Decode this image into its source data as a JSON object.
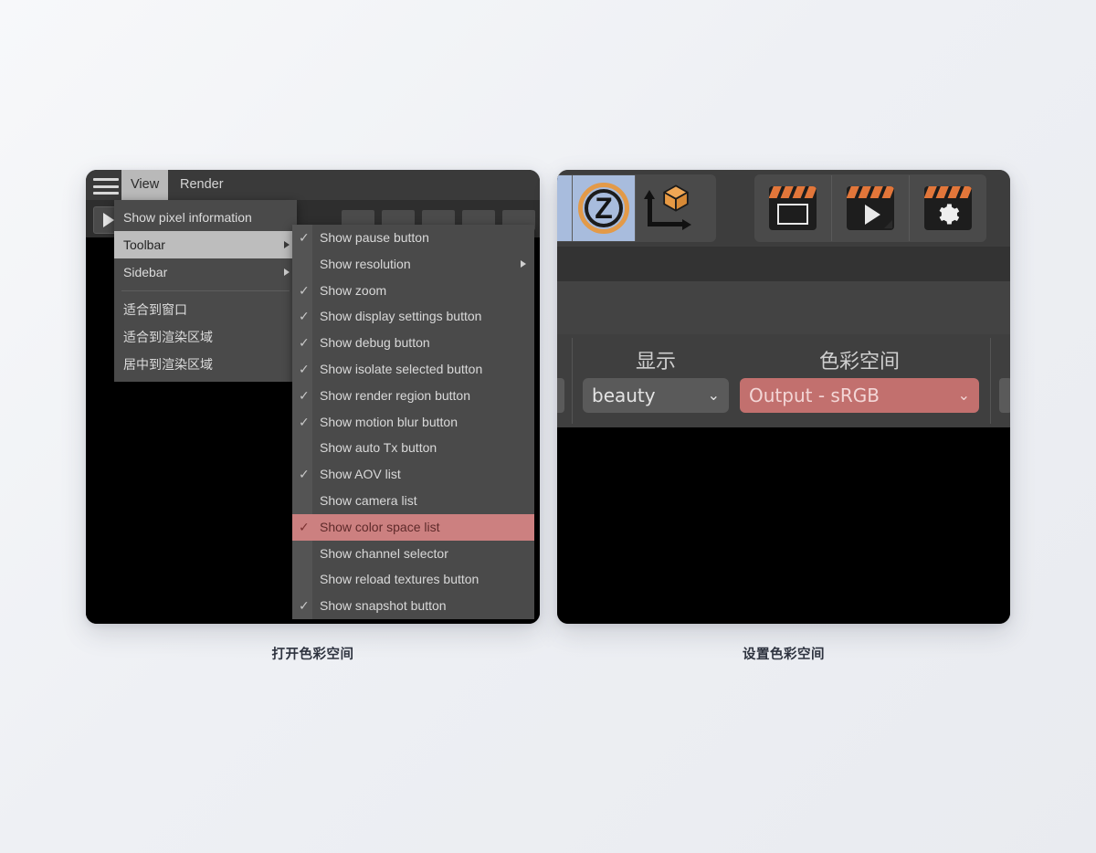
{
  "left_figure": {
    "caption": "打开色彩空间",
    "menubar": {
      "hamburger_icon": "hamburger-menu-icon",
      "items": [
        {
          "label": "View",
          "active": true
        },
        {
          "label": "Render",
          "active": false
        }
      ]
    },
    "viewer": {
      "play_button_icon": "play-icon"
    },
    "view_menu": {
      "items": [
        {
          "label": "Show pixel information",
          "highlighted": false,
          "has_submenu": false
        },
        {
          "label": "Toolbar",
          "highlighted": true,
          "has_submenu": true
        },
        {
          "label": "Sidebar",
          "highlighted": false,
          "has_submenu": true
        },
        {
          "separator": true
        },
        {
          "label": "适合到窗口",
          "highlighted": false,
          "has_submenu": false
        },
        {
          "label": "适合到渲染区域",
          "highlighted": false,
          "has_submenu": false
        },
        {
          "label": "居中到渲染区域",
          "highlighted": false,
          "has_submenu": false
        }
      ]
    },
    "toolbar_submenu": {
      "items": [
        {
          "label": "Show pause button",
          "checked": true,
          "has_submenu": false,
          "highlighted": false
        },
        {
          "label": "Show resolution",
          "checked": false,
          "has_submenu": true,
          "highlighted": false
        },
        {
          "label": "Show zoom",
          "checked": true,
          "has_submenu": false,
          "highlighted": false
        },
        {
          "label": "Show display settings button",
          "checked": true,
          "has_submenu": false,
          "highlighted": false
        },
        {
          "label": "Show debug button",
          "checked": true,
          "has_submenu": false,
          "highlighted": false
        },
        {
          "label": "Show isolate selected button",
          "checked": true,
          "has_submenu": false,
          "highlighted": false
        },
        {
          "label": "Show render region button",
          "checked": true,
          "has_submenu": false,
          "highlighted": false
        },
        {
          "label": "Show motion blur button",
          "checked": true,
          "has_submenu": false,
          "highlighted": false
        },
        {
          "label": "Show auto Tx button",
          "checked": false,
          "has_submenu": false,
          "highlighted": false
        },
        {
          "label": "Show AOV list",
          "checked": true,
          "has_submenu": false,
          "highlighted": false
        },
        {
          "label": "Show camera list",
          "checked": false,
          "has_submenu": false,
          "highlighted": false
        },
        {
          "label": "Show color space list",
          "checked": true,
          "has_submenu": false,
          "highlighted": true
        },
        {
          "label": "Show channel selector",
          "checked": false,
          "has_submenu": false,
          "highlighted": false
        },
        {
          "label": "Show reload textures button",
          "checked": false,
          "has_submenu": false,
          "highlighted": false
        },
        {
          "label": "Show snapshot button",
          "checked": true,
          "has_submenu": false,
          "highlighted": false
        }
      ],
      "check_glyph": "✓",
      "highlight_color": "#cc8080"
    }
  },
  "right_figure": {
    "caption": "设置色彩空间",
    "toolbar": {
      "icons": [
        {
          "name": "z-logo-partial-icon",
          "selected": true
        },
        {
          "name": "z-logo-icon",
          "selected": true,
          "letter": "Z"
        },
        {
          "name": "axis-cube-icon",
          "selected": false
        },
        {
          "name": "clapper-region-icon",
          "selected": false
        },
        {
          "name": "clapper-play-icon",
          "selected": false
        },
        {
          "name": "clapper-settings-icon",
          "selected": false
        }
      ],
      "accent_color": "#e2763a",
      "selected_color": "#a8bcdd"
    },
    "controls": {
      "columns": [
        {
          "label": "显示",
          "value": "beauty",
          "style": "grey",
          "chevron_icon": "chevron-down-icon"
        },
        {
          "label": "色彩空间",
          "value": "Output - sRGB",
          "style": "red",
          "chevron_icon": "chevron-down-icon",
          "highlight_color": "#c2706e"
        }
      ]
    }
  }
}
